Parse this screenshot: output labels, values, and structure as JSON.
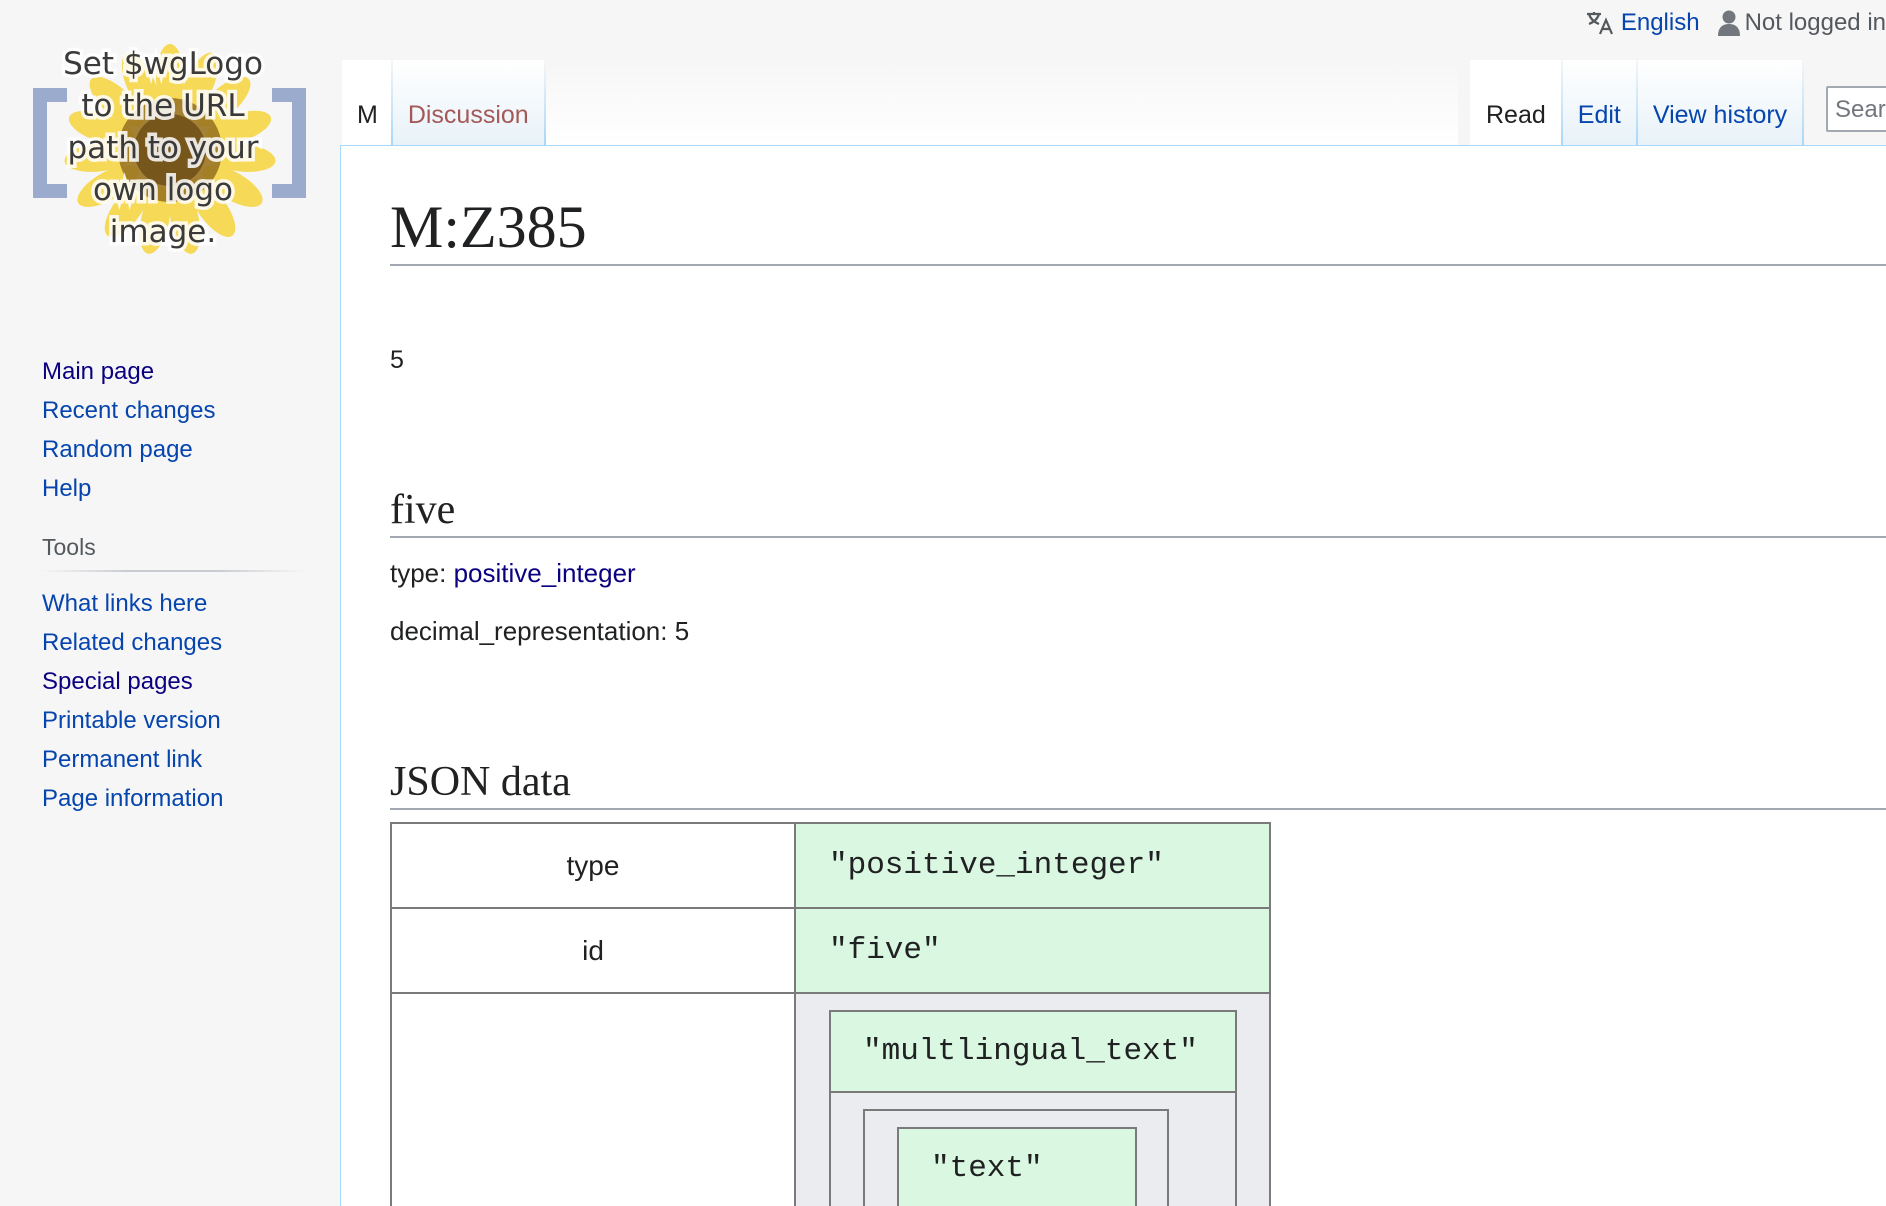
{
  "personal": {
    "language": "English",
    "user_status": "Not logged in"
  },
  "logo": {
    "lines": [
      "Set $wgLogo",
      "to the URL",
      "path to your",
      "own logo",
      "image."
    ]
  },
  "navigation": {
    "items": [
      {
        "label": "Main page"
      },
      {
        "label": "Recent changes"
      },
      {
        "label": "Random page"
      },
      {
        "label": "Help"
      }
    ]
  },
  "tools": {
    "heading": "Tools",
    "items": [
      {
        "label": "What links here"
      },
      {
        "label": "Related changes"
      },
      {
        "label": "Special pages"
      },
      {
        "label": "Printable version"
      },
      {
        "label": "Permanent link"
      },
      {
        "label": "Page information"
      }
    ]
  },
  "tabs": {
    "namespace": "M",
    "discussion": "Discussion",
    "read": "Read",
    "edit": "Edit",
    "history": "View history"
  },
  "search": {
    "placeholder": "Search"
  },
  "page": {
    "title": "M:Z385",
    "value": "5"
  },
  "sections": {
    "five": {
      "heading": "five",
      "type_label": "type: ",
      "type_link": "positive_integer",
      "decimal_label": "decimal_representation: 5"
    },
    "json": {
      "heading": "JSON data"
    }
  },
  "json_table": {
    "rows": [
      {
        "key": "type",
        "value": "\"positive_integer\""
      },
      {
        "key": "id",
        "value": "\"five\""
      }
    ],
    "nested": {
      "type_value": "\"multlingual_text\"",
      "inner_value": "\"text\""
    }
  },
  "colors": {
    "link": "#0645ad",
    "visited": "#0b0080",
    "redlink": "#a55858",
    "json_value_bg": "#d9f7e1",
    "json_nested_bg": "#eaecf0"
  }
}
